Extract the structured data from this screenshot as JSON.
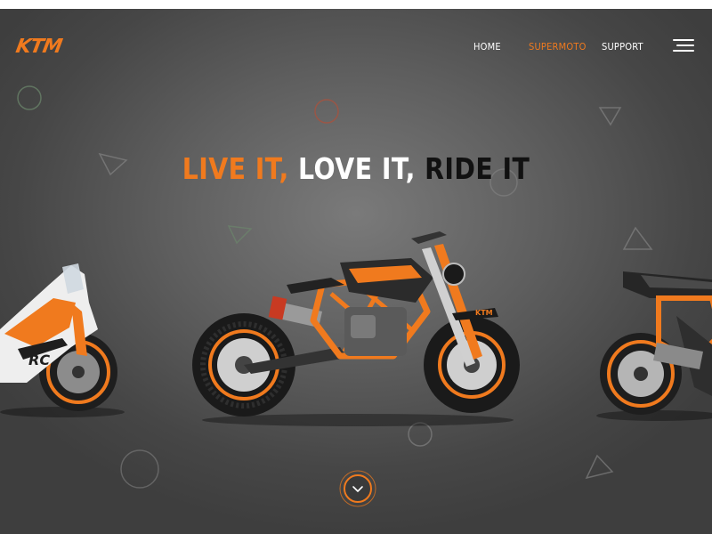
{
  "brand": {
    "logo_text": "KTM",
    "accent_color": "#f07a1e"
  },
  "nav": {
    "items": [
      {
        "label": "HOME",
        "active": false
      },
      {
        "label": "SUPERMOTO",
        "active": true
      },
      {
        "label": "SUPPORT",
        "active": false
      }
    ],
    "menu_icon": "hamburger-menu-icon"
  },
  "hero": {
    "headline": {
      "part1": "LIVE IT,",
      "part2": "LOVE IT,",
      "part3": "RIDE IT"
    },
    "bikes": [
      {
        "name": "KTM RC sport bike",
        "decal": "RC"
      },
      {
        "name": "KTM Duke supermoto",
        "decal": "KTM"
      },
      {
        "name": "KTM Duke naked bike",
        "decal": ""
      }
    ],
    "scroll_icon": "chevron-down-icon"
  }
}
